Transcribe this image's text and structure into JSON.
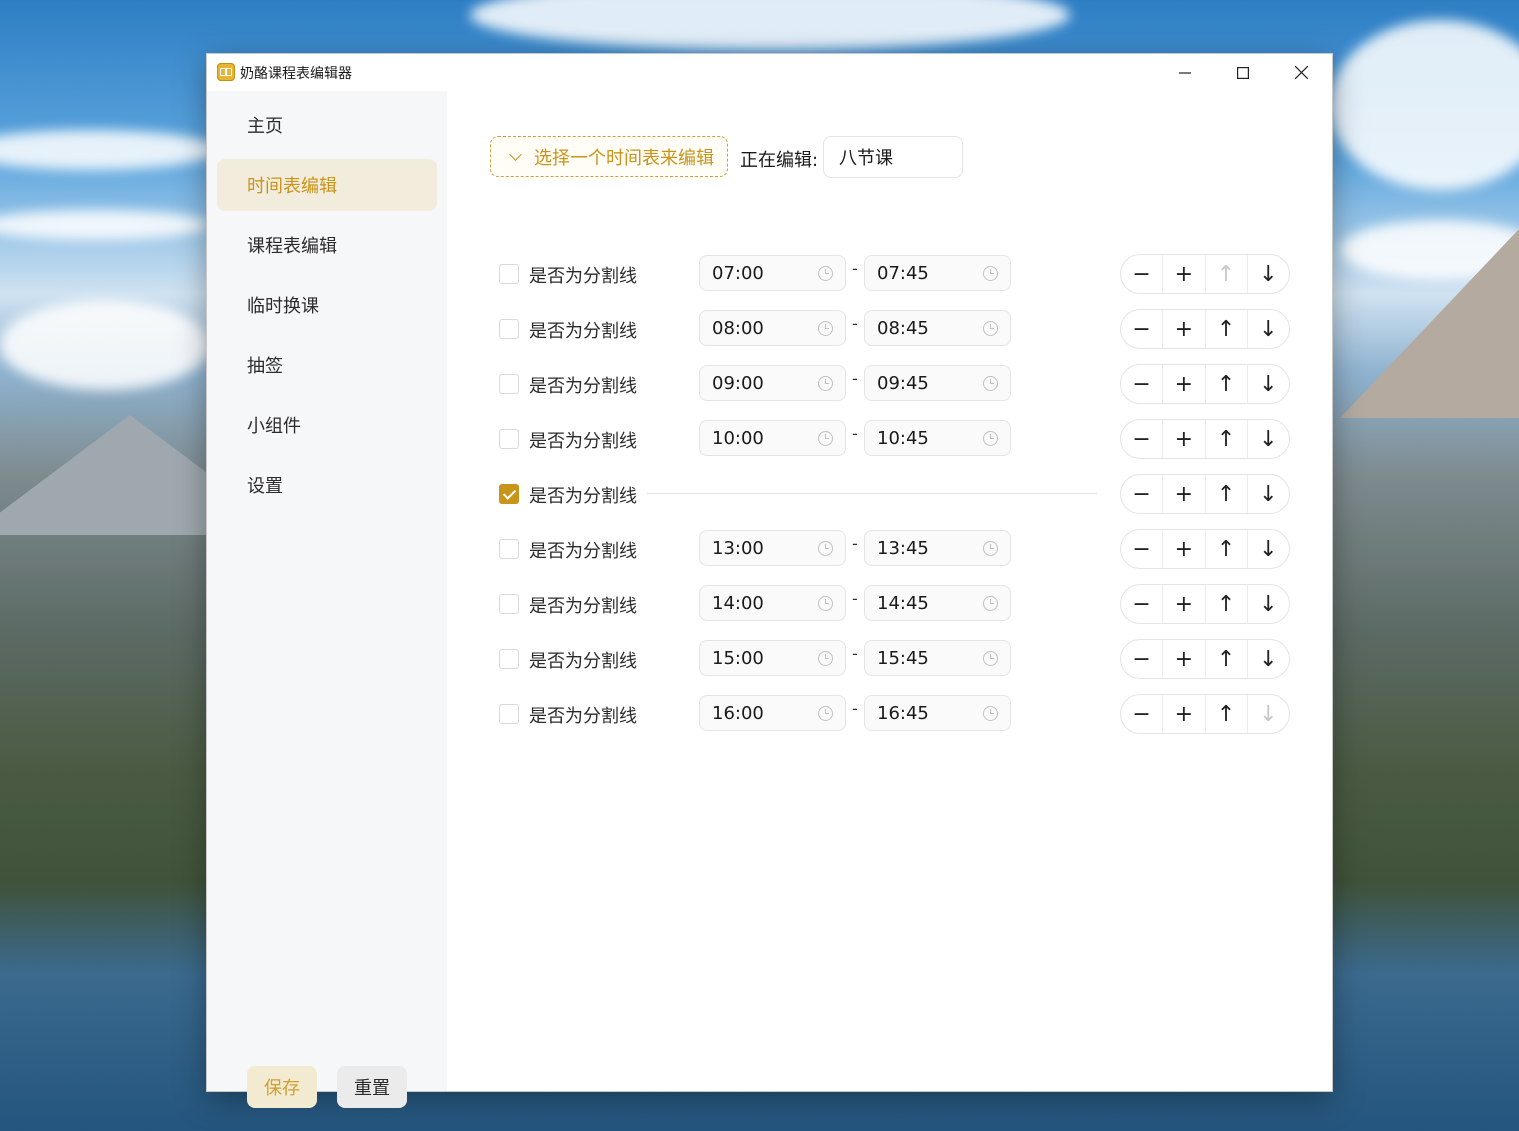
{
  "window": {
    "title": "奶酪课程表编辑器",
    "controls": {
      "minimize": "—",
      "maximize": "☐",
      "close": "✕"
    }
  },
  "sidebar": {
    "items": [
      {
        "label": "主页",
        "active": false
      },
      {
        "label": "时间表编辑",
        "active": true
      },
      {
        "label": "课程表编辑",
        "active": false
      },
      {
        "label": "临时换课",
        "active": false
      },
      {
        "label": "抽签",
        "active": false
      },
      {
        "label": "小组件",
        "active": false
      },
      {
        "label": "设置",
        "active": false
      }
    ],
    "save_label": "保存",
    "reset_label": "重置"
  },
  "editor": {
    "select_placeholder": "选择一个时间表来编辑",
    "editing_label": "正在编辑:",
    "editing_value": "八节课"
  },
  "rows": [
    {
      "label": "是否为分割线",
      "checked": false,
      "start": "07:00",
      "end": "07:45",
      "up_disabled": true,
      "down_disabled": false
    },
    {
      "label": "是否为分割线",
      "checked": false,
      "start": "08:00",
      "end": "08:45",
      "up_disabled": false,
      "down_disabled": false
    },
    {
      "label": "是否为分割线",
      "checked": false,
      "start": "09:00",
      "end": "09:45",
      "up_disabled": false,
      "down_disabled": false
    },
    {
      "label": "是否为分割线",
      "checked": false,
      "start": "10:00",
      "end": "10:45",
      "up_disabled": false,
      "down_disabled": false
    },
    {
      "label": "是否为分割线",
      "checked": true,
      "start": "",
      "end": "",
      "up_disabled": false,
      "down_disabled": false
    },
    {
      "label": "是否为分割线",
      "checked": false,
      "start": "13:00",
      "end": "13:45",
      "up_disabled": false,
      "down_disabled": false
    },
    {
      "label": "是否为分割线",
      "checked": false,
      "start": "14:00",
      "end": "14:45",
      "up_disabled": false,
      "down_disabled": false
    },
    {
      "label": "是否为分割线",
      "checked": false,
      "start": "15:00",
      "end": "15:45",
      "up_disabled": false,
      "down_disabled": false
    },
    {
      "label": "是否为分割线",
      "checked": false,
      "start": "16:00",
      "end": "16:45",
      "up_disabled": false,
      "down_disabled": true
    }
  ],
  "row_buttons": {
    "remove": "−",
    "add": "+",
    "up": "↑",
    "down": "↓"
  },
  "colors": {
    "accent": "#c9941a",
    "active_bg": "#f2ecdc",
    "sidebar_bg": "#f6f7f9"
  },
  "icons": {
    "app": "timetable-icon",
    "time": "clock-icon",
    "dropdown": "chevron-down-icon"
  }
}
